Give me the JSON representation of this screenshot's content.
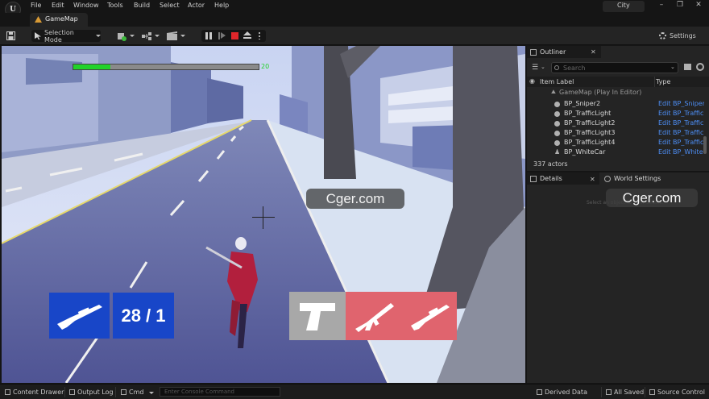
{
  "menu": {
    "logo": "U",
    "items": [
      "File",
      "Edit",
      "Window",
      "Tools",
      "Build",
      "Select",
      "Actor",
      "Help"
    ],
    "project": "City"
  },
  "tabs": {
    "doc_tab": "GameMap"
  },
  "toolbar": {
    "selection_mode": "Selection Mode",
    "settings": "Settings"
  },
  "viewport": {
    "health_value": "20",
    "health_fraction": 0.2,
    "ammo": "28 / 1",
    "watermark": "Cger.com",
    "colors": {
      "weapon_blue": "#1846c8",
      "weapon_red": "#e0646e",
      "weapon_grey": "#a8a8a8",
      "health_green": "#22d22a"
    }
  },
  "outliner": {
    "tab": "Outliner",
    "search_placeholder": "Search",
    "col_label": "Item Label",
    "col_type": "Type",
    "root": "GameMap (Play In Editor)",
    "rows": [
      {
        "name": "BP_Sniper2",
        "type": "Edit BP_Sniper"
      },
      {
        "name": "BP_TrafficLight",
        "type": "Edit BP_Traffic"
      },
      {
        "name": "BP_TrafficLight2",
        "type": "Edit BP_Traffic"
      },
      {
        "name": "BP_TrafficLight3",
        "type": "Edit BP_Traffic"
      },
      {
        "name": "BP_TrafficLight4",
        "type": "Edit BP_Traffic"
      },
      {
        "name": "BP_WhiteCar",
        "type": "Edit BP_WhiteC"
      }
    ],
    "actor_count": "337 actors"
  },
  "details": {
    "tab_details": "Details",
    "tab_world": "World Settings",
    "hint": "Select an object to view details.",
    "watermark": "Cger.com"
  },
  "statusbar": {
    "content_drawer": "Content Drawer",
    "output_log": "Output Log",
    "cmd": "Cmd",
    "console_placeholder": "Enter Console Command",
    "derived_data": "Derived Data",
    "all_saved": "All Saved",
    "source_control": "Source Control"
  }
}
